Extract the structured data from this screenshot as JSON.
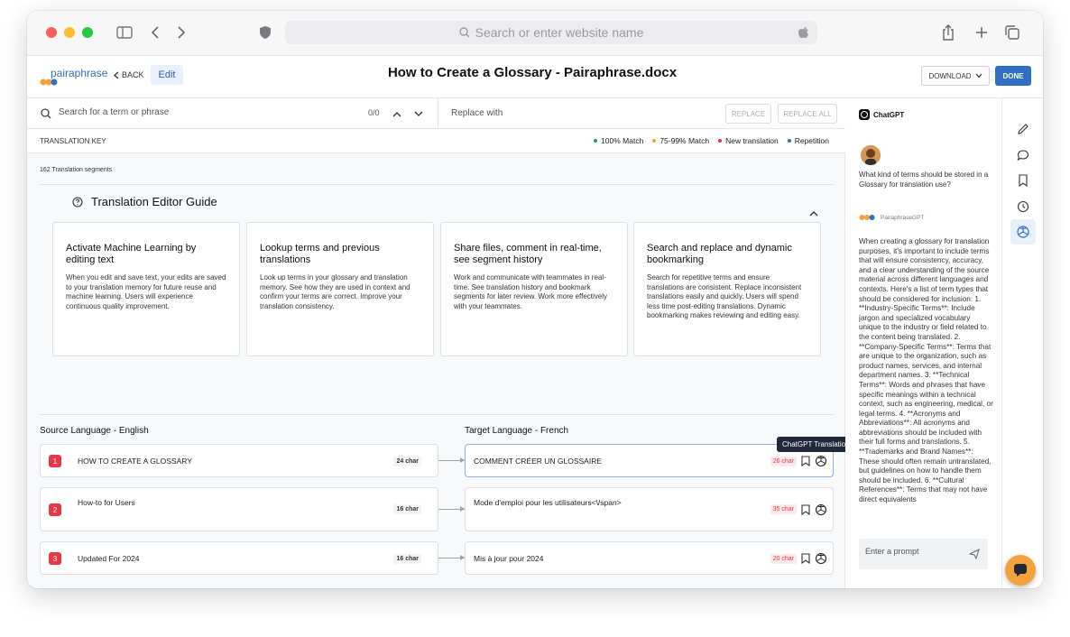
{
  "browser": {
    "address_placeholder": "Search or enter website name"
  },
  "header": {
    "logo_text": "pairaphrase",
    "back_label": "BACK",
    "edit_label": "Edit",
    "doc_title": "How to Create a Glossary - Pairaphrase.docx",
    "download_label": "DOWNLOAD",
    "done_label": "DONE"
  },
  "search": {
    "placeholder": "Search for a term or phrase",
    "counter": "0/0",
    "replace_placeholder": "Replace with",
    "replace_label": "REPLACE",
    "replace_all_label": "REPLACE ALL"
  },
  "translation_key": {
    "label": "TRANSLATION KEY",
    "legend": [
      {
        "label": "100% Match",
        "color": "#22a06b"
      },
      {
        "label": "75-99% Match",
        "color": "#f4a23b"
      },
      {
        "label": "New translation",
        "color": "#e63946"
      },
      {
        "label": "Repetition",
        "color": "#3b6fd4"
      }
    ]
  },
  "segments_count": "162 Translation segments",
  "guide": {
    "title": "Translation Editor Guide",
    "cards": [
      {
        "title": "Activate Machine Learning by editing text",
        "body": "When you edit and save text, your edits are saved to your translation memory for future reuse and machine learning. Users will experience continuous quality improvement."
      },
      {
        "title": "Lookup terms and previous translations",
        "body": "Look up terms in your glossary and translation memory. See how they are used in context and confirm your terms are correct. Improve your translation consistency."
      },
      {
        "title": "Share files, comment in real-time, see segment history",
        "body": "Work and communicate with teammates in real-time. See translation history and bookmark segments for later review. Work more effectively with your teammates."
      },
      {
        "title": "Search and replace and dynamic bookmarking",
        "body": "Search for repetitive terms and ensure translations are consistent. Replace inconsistent translations easily and quickly. Users will spend less time post-editing translations. Dynamic bookmarking makes reviewing and editing easy."
      }
    ]
  },
  "source_label": "Source Language - English",
  "target_label": "Target Language - French",
  "segments": [
    {
      "num": "1",
      "source": "HOW TO CREATE A GLOSSARY",
      "source_chars": "24 char",
      "target": "COMMENT CRÉER UN GLOSSAIRE",
      "target_chars": "26 char"
    },
    {
      "num": "2",
      "source": "How-to for Users",
      "source_chars": "16 char",
      "target": "Mode d'emploi pour les utilisateurs<\\/span>",
      "target_chars": "35 char"
    },
    {
      "num": "3",
      "source": "Updated For 2024",
      "source_chars": "16 char",
      "target": "Mis à jour pour 2024",
      "target_chars": "20 char"
    }
  ],
  "tooltip": "ChatGPT Translation",
  "chat": {
    "title": "ChatGPT",
    "question": "What kind of terms should be stored in a Glossary for translation use?",
    "bot_name": "PairaphraseGPT",
    "answer": "When creating a glossary for translation purposes, it's important to include terms that will ensure consistency, accuracy, and a clear understanding of the source material across different languages and contexts. Here's a list of term types that should be considered for inclusion: 1. **Industry-Specific Terms**: Include jargon and specialized vocabulary unique to the industry or field related to the content being translated. 2. **Company-Specific Terms**: Terms that are unique to the organization, such as product names, services, and internal department names. 3. **Technical Terms**: Words and phrases that have specific meanings within a technical context, such as engineering, medical, or legal terms. 4. **Acronyms and Abbreviations**: All acronyms and abbreviations should be included with their full forms and translations. 5. **Trademarks and Brand Names**: These should often remain untranslated, but guidelines on how to handle them should be included. 6. **Cultural References**: Terms that may not have direct equivalents",
    "prompt_placeholder": "Enter a prompt"
  }
}
